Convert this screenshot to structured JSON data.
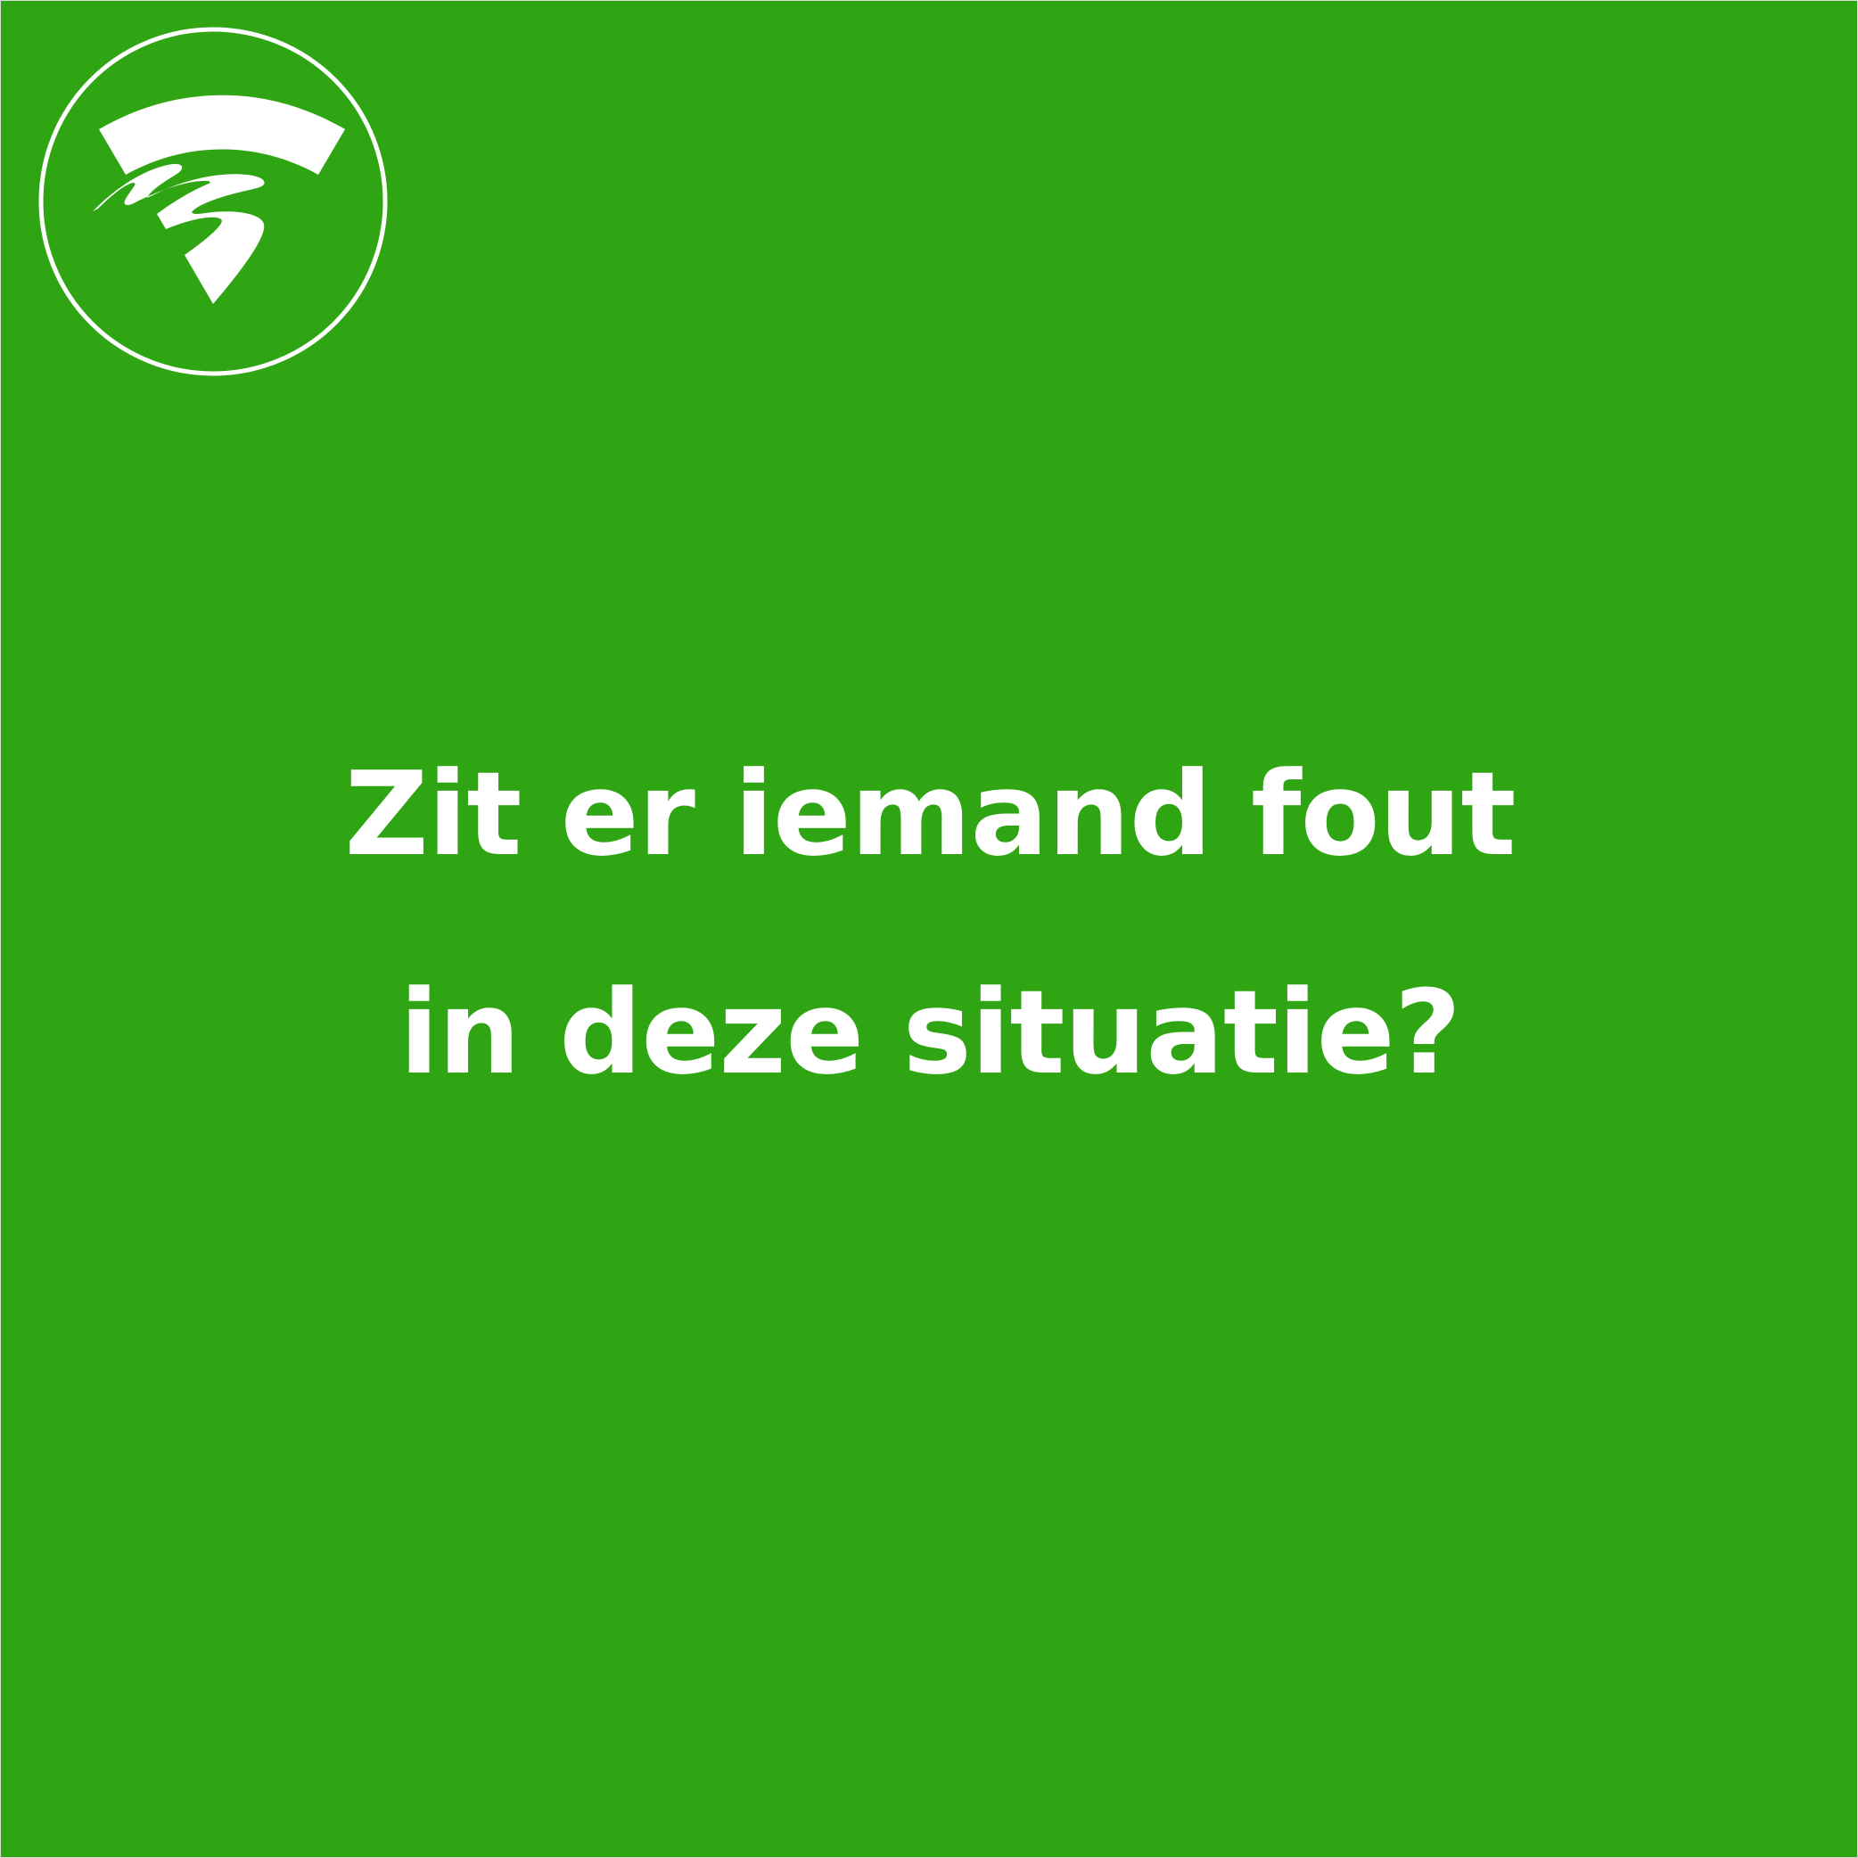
{
  "colors": {
    "background": "#2fa514",
    "foreground": "#ffffff"
  },
  "logo": {
    "icon": "cyclist-road-logo-icon"
  },
  "headline": {
    "line1": "Zit er iemand fout",
    "line2": "in deze situatie?"
  }
}
